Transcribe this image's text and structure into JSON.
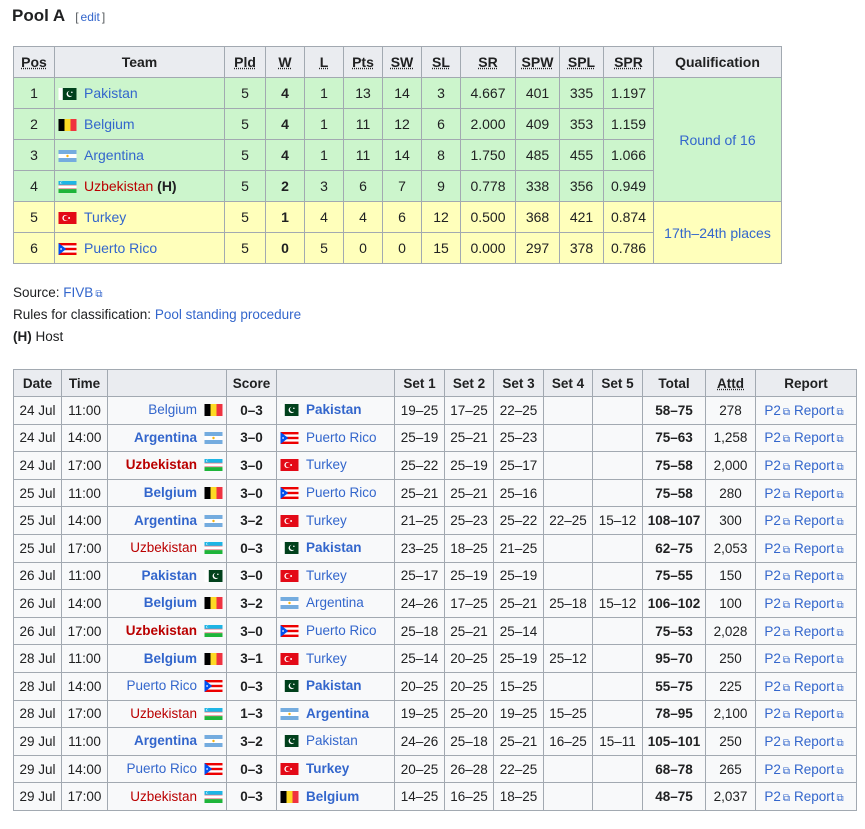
{
  "heading": {
    "title": "Pool A",
    "edit_label": "edit"
  },
  "standings": {
    "headers": [
      "Pos",
      "Team",
      "Pld",
      "W",
      "L",
      "Pts",
      "SW",
      "SL",
      "SR",
      "SPW",
      "SPL",
      "SPR",
      "Qualification"
    ],
    "rows": [
      {
        "pos": "1",
        "team": "Pakistan",
        "flag": "pakistan",
        "host": "",
        "pld": "5",
        "w": "4",
        "l": "1",
        "pts": "13",
        "sw": "14",
        "sl": "3",
        "sr": "4.667",
        "spw": "401",
        "spl": "335",
        "spr": "1.197"
      },
      {
        "pos": "2",
        "team": "Belgium",
        "flag": "belgium",
        "host": "",
        "pld": "5",
        "w": "4",
        "l": "1",
        "pts": "11",
        "sw": "12",
        "sl": "6",
        "sr": "2.000",
        "spw": "409",
        "spl": "353",
        "spr": "1.159"
      },
      {
        "pos": "3",
        "team": "Argentina",
        "flag": "argentina",
        "host": "",
        "pld": "5",
        "w": "4",
        "l": "1",
        "pts": "11",
        "sw": "14",
        "sl": "8",
        "sr": "1.750",
        "spw": "485",
        "spl": "455",
        "spr": "1.066"
      },
      {
        "pos": "4",
        "team": "Uzbekistan",
        "flag": "uzbekistan",
        "host": "(H)",
        "pld": "5",
        "w": "2",
        "l": "3",
        "pts": "6",
        "sw": "7",
        "sl": "9",
        "sr": "0.778",
        "spw": "338",
        "spl": "356",
        "spr": "0.949"
      },
      {
        "pos": "5",
        "team": "Turkey",
        "flag": "turkey",
        "host": "",
        "pld": "5",
        "w": "1",
        "l": "4",
        "pts": "4",
        "sw": "6",
        "sl": "12",
        "sr": "0.500",
        "spw": "368",
        "spl": "421",
        "spr": "0.874"
      },
      {
        "pos": "6",
        "team": "Puerto Rico",
        "flag": "puertorico",
        "host": "",
        "pld": "5",
        "w": "0",
        "l": "5",
        "pts": "0",
        "sw": "0",
        "sl": "15",
        "sr": "0.000",
        "spw": "297",
        "spl": "378",
        "spr": "0.786"
      }
    ],
    "qualification": [
      "Round of 16",
      "17th–24th places"
    ]
  },
  "notes": {
    "source_label": "Source:",
    "source_link": "FIVB",
    "rules_label": "Rules for classification:",
    "rules_link": "Pool standing procedure",
    "host_key": "(H)",
    "host_text": "Host"
  },
  "matches": {
    "headers": [
      "Date",
      "Time",
      "",
      "Score",
      "",
      "Set 1",
      "Set 2",
      "Set 3",
      "Set 4",
      "Set 5",
      "Total",
      "Attd",
      "Report"
    ],
    "report_links": [
      "P2",
      "Report"
    ],
    "rows": [
      {
        "date": "24 Jul",
        "time": "11:00",
        "home": "Belgium",
        "hflag": "belgium",
        "hwin": false,
        "hhost": false,
        "score": "0–3",
        "away": "Pakistan",
        "aflag": "pakistan",
        "awin": true,
        "ahost": false,
        "s1": "19–25",
        "s2": "17–25",
        "s3": "22–25",
        "s4": "",
        "s5": "",
        "total": "58–75",
        "attd": "278"
      },
      {
        "date": "24 Jul",
        "time": "14:00",
        "home": "Argentina",
        "hflag": "argentina",
        "hwin": true,
        "hhost": false,
        "score": "3–0",
        "away": "Puerto Rico",
        "aflag": "puertorico",
        "awin": false,
        "ahost": false,
        "s1": "25–19",
        "s2": "25–21",
        "s3": "25–23",
        "s4": "",
        "s5": "",
        "total": "75–63",
        "attd": "1,258"
      },
      {
        "date": "24 Jul",
        "time": "17:00",
        "home": "Uzbekistan",
        "hflag": "uzbekistan",
        "hwin": true,
        "hhost": true,
        "score": "3–0",
        "away": "Turkey",
        "aflag": "turkey",
        "awin": false,
        "ahost": false,
        "s1": "25–22",
        "s2": "25–19",
        "s3": "25–17",
        "s4": "",
        "s5": "",
        "total": "75–58",
        "attd": "2,000"
      },
      {
        "date": "25 Jul",
        "time": "11:00",
        "home": "Belgium",
        "hflag": "belgium",
        "hwin": true,
        "hhost": false,
        "score": "3–0",
        "away": "Puerto Rico",
        "aflag": "puertorico",
        "awin": false,
        "ahost": false,
        "s1": "25–21",
        "s2": "25–21",
        "s3": "25–16",
        "s4": "",
        "s5": "",
        "total": "75–58",
        "attd": "280"
      },
      {
        "date": "25 Jul",
        "time": "14:00",
        "home": "Argentina",
        "hflag": "argentina",
        "hwin": true,
        "hhost": false,
        "score": "3–2",
        "away": "Turkey",
        "aflag": "turkey",
        "awin": false,
        "ahost": false,
        "s1": "21–25",
        "s2": "25–23",
        "s3": "25–22",
        "s4": "22–25",
        "s5": "15–12",
        "total": "108–107",
        "attd": "300"
      },
      {
        "date": "25 Jul",
        "time": "17:00",
        "home": "Uzbekistan",
        "hflag": "uzbekistan",
        "hwin": false,
        "hhost": true,
        "score": "0–3",
        "away": "Pakistan",
        "aflag": "pakistan",
        "awin": true,
        "ahost": false,
        "s1": "23–25",
        "s2": "18–25",
        "s3": "21–25",
        "s4": "",
        "s5": "",
        "total": "62–75",
        "attd": "2,053"
      },
      {
        "date": "26 Jul",
        "time": "11:00",
        "home": "Pakistan",
        "hflag": "pakistan",
        "hwin": true,
        "hhost": false,
        "score": "3–0",
        "away": "Turkey",
        "aflag": "turkey",
        "awin": false,
        "ahost": false,
        "s1": "25–17",
        "s2": "25–19",
        "s3": "25–19",
        "s4": "",
        "s5": "",
        "total": "75–55",
        "attd": "150"
      },
      {
        "date": "26 Jul",
        "time": "14:00",
        "home": "Belgium",
        "hflag": "belgium",
        "hwin": true,
        "hhost": false,
        "score": "3–2",
        "away": "Argentina",
        "aflag": "argentina",
        "awin": false,
        "ahost": false,
        "s1": "24–26",
        "s2": "17–25",
        "s3": "25–21",
        "s4": "25–18",
        "s5": "15–12",
        "total": "106–102",
        "attd": "100"
      },
      {
        "date": "26 Jul",
        "time": "17:00",
        "home": "Uzbekistan",
        "hflag": "uzbekistan",
        "hwin": true,
        "hhost": true,
        "score": "3–0",
        "away": "Puerto Rico",
        "aflag": "puertorico",
        "awin": false,
        "ahost": false,
        "s1": "25–18",
        "s2": "25–21",
        "s3": "25–14",
        "s4": "",
        "s5": "",
        "total": "75–53",
        "attd": "2,028"
      },
      {
        "date": "28 Jul",
        "time": "11:00",
        "home": "Belgium",
        "hflag": "belgium",
        "hwin": true,
        "hhost": false,
        "score": "3–1",
        "away": "Turkey",
        "aflag": "turkey",
        "awin": false,
        "ahost": false,
        "s1": "25–14",
        "s2": "20–25",
        "s3": "25–19",
        "s4": "25–12",
        "s5": "",
        "total": "95–70",
        "attd": "250"
      },
      {
        "date": "28 Jul",
        "time": "14:00",
        "home": "Puerto Rico",
        "hflag": "puertorico",
        "hwin": false,
        "hhost": false,
        "score": "0–3",
        "away": "Pakistan",
        "aflag": "pakistan",
        "awin": true,
        "ahost": false,
        "s1": "20–25",
        "s2": "20–25",
        "s3": "15–25",
        "s4": "",
        "s5": "",
        "total": "55–75",
        "attd": "225"
      },
      {
        "date": "28 Jul",
        "time": "17:00",
        "home": "Uzbekistan",
        "hflag": "uzbekistan",
        "hwin": false,
        "hhost": true,
        "score": "1–3",
        "away": "Argentina",
        "aflag": "argentina",
        "awin": true,
        "ahost": false,
        "s1": "19–25",
        "s2": "25–20",
        "s3": "19–25",
        "s4": "15–25",
        "s5": "",
        "total": "78–95",
        "attd": "2,100"
      },
      {
        "date": "29 Jul",
        "time": "11:00",
        "home": "Argentina",
        "hflag": "argentina",
        "hwin": true,
        "hhost": false,
        "score": "3–2",
        "away": "Pakistan",
        "aflag": "pakistan",
        "awin": false,
        "ahost": false,
        "s1": "24–26",
        "s2": "25–18",
        "s3": "25–21",
        "s4": "16–25",
        "s5": "15–11",
        "total": "105–101",
        "attd": "250"
      },
      {
        "date": "29 Jul",
        "time": "14:00",
        "home": "Puerto Rico",
        "hflag": "puertorico",
        "hwin": false,
        "hhost": false,
        "score": "0–3",
        "away": "Turkey",
        "aflag": "turkey",
        "awin": true,
        "ahost": false,
        "s1": "20–25",
        "s2": "26–28",
        "s3": "22–25",
        "s4": "",
        "s5": "",
        "total": "68–78",
        "attd": "265"
      },
      {
        "date": "29 Jul",
        "time": "17:00",
        "home": "Uzbekistan",
        "hflag": "uzbekistan",
        "hwin": false,
        "hhost": true,
        "score": "0–3",
        "away": "Belgium",
        "aflag": "belgium",
        "awin": true,
        "ahost": false,
        "s1": "14–25",
        "s2": "16–25",
        "s3": "18–25",
        "s4": "",
        "s5": "",
        "total": "48–75",
        "attd": "2,037"
      }
    ]
  }
}
